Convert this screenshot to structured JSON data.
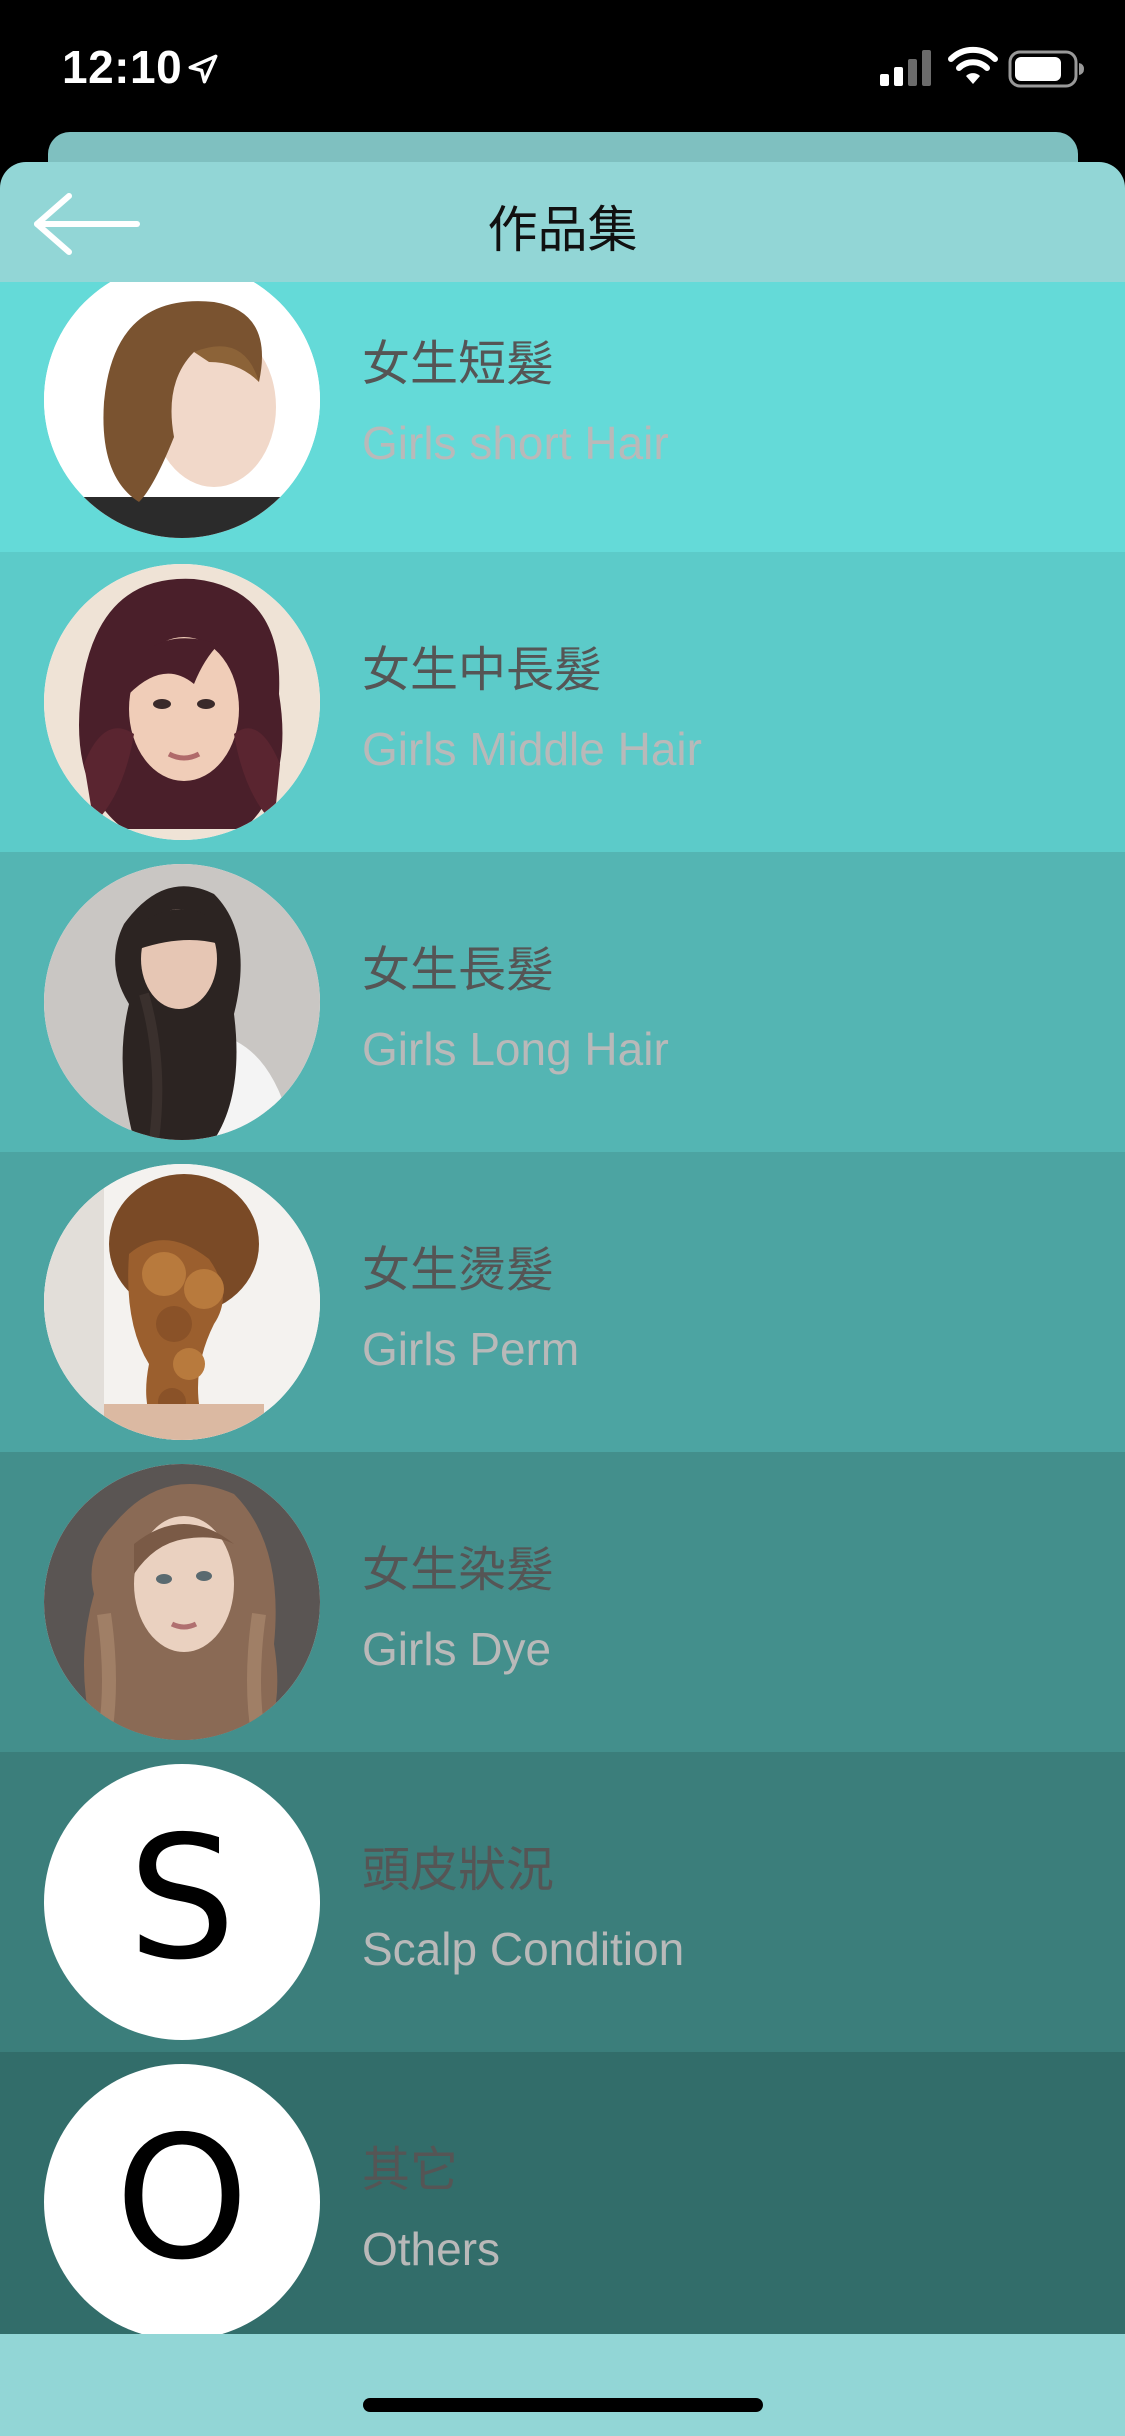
{
  "status_bar": {
    "time": "12:10",
    "icons": [
      "location-arrow-icon",
      "signal-icon",
      "wifi-icon",
      "battery-icon"
    ]
  },
  "nav": {
    "title": "作品集",
    "back_icon": "arrow-left-icon"
  },
  "list": {
    "items": [
      {
        "title": "女生短髮",
        "subtitle": "Girls short Hair",
        "avatar": "photo-short-hair",
        "bg": "#64dad8"
      },
      {
        "title": "女生中長髮",
        "subtitle": "Girls Middle Hair",
        "avatar": "photo-middle-hair",
        "bg": "#5ccbc9"
      },
      {
        "title": "女生長髮",
        "subtitle": "Girls Long Hair",
        "avatar": "photo-long-hair",
        "bg": "#54b5b3"
      },
      {
        "title": "女生燙髮",
        "subtitle": "Girls Perm",
        "avatar": "photo-perm",
        "bg": "#4ca4a2"
      },
      {
        "title": "女生染髮",
        "subtitle": "Girls Dye",
        "avatar": "photo-dye",
        "bg": "#438f8c"
      },
      {
        "title": "頭皮狀況",
        "subtitle": "Scalp Condition",
        "avatar_letter": "S",
        "bg": "#3b7e7b"
      },
      {
        "title": "其它",
        "subtitle": "Others",
        "avatar_letter": "O",
        "bg": "#326d6a"
      }
    ]
  },
  "colors": {
    "sheet": "#92d6d6",
    "sheet_back": "#7fc0c0",
    "title_text": "#555555",
    "subtitle_text": "#b9b9b9"
  }
}
